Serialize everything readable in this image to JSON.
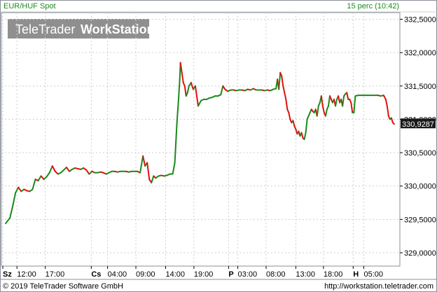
{
  "header": {
    "instrument": "EUR/HUF Spot",
    "period": "15 perc (10:42)"
  },
  "logo": {
    "prefix": "TeleTrader",
    "suffix": "WorkStation"
  },
  "footer": {
    "copyright": "© 2019 TeleTrader Software GmbH",
    "url": "http://workstation.teletrader.com"
  },
  "colors": {
    "up": "#1a8a1a",
    "down": "#e01010",
    "grid": "#cfcfcf",
    "last_label_bg": "#1a1a1a"
  },
  "chart_data": {
    "type": "line",
    "title": "EUR/HUF Spot",
    "ylim": [
      328.8,
      332.6
    ],
    "y_ticks": [
      "332,5000",
      "332,0000",
      "331,5000",
      "331,0000",
      "330,5000",
      "330,0000",
      "329,5000",
      "329,0000"
    ],
    "y_tick_values": [
      332.5,
      332.0,
      331.5,
      331.0,
      330.5,
      330.0,
      329.5,
      329.0
    ],
    "last_value": 330.9287,
    "last_value_label": "330,9287",
    "x_range": [
      0,
      563
    ],
    "x_ticks": [
      {
        "label": "Sz",
        "bold": true,
        "x": 2
      },
      {
        "label": "12:00",
        "bold": false,
        "x": 22
      },
      {
        "label": "17:00",
        "bold": false,
        "x": 62
      },
      {
        "label": "Cs",
        "bold": true,
        "x": 127
      },
      {
        "label": "04:00",
        "bold": false,
        "x": 150
      },
      {
        "label": "09:00",
        "bold": false,
        "x": 190
      },
      {
        "label": "14:00",
        "bold": false,
        "x": 232
      },
      {
        "label": "19:00",
        "bold": false,
        "x": 272
      },
      {
        "label": "P",
        "bold": true,
        "x": 321
      },
      {
        "label": "03:00",
        "bold": false,
        "x": 334
      },
      {
        "label": "08:00",
        "bold": false,
        "x": 374
      },
      {
        "label": "13:00",
        "bold": false,
        "x": 416
      },
      {
        "label": "18:00",
        "bold": false,
        "x": 455
      },
      {
        "label": "H",
        "bold": true,
        "x": 497
      },
      {
        "label": "05:00",
        "bold": false,
        "x": 512
      }
    ],
    "series": [
      {
        "values": [
          [
            6,
            329.44
          ],
          [
            12,
            329.52
          ],
          [
            16,
            329.7
          ],
          [
            20,
            329.9
          ],
          [
            24,
            329.98
          ],
          [
            28,
            329.92
          ],
          [
            32,
            329.95
          ],
          [
            36,
            329.93
          ],
          [
            40,
            329.92
          ],
          [
            44,
            329.95
          ],
          [
            48,
            330.1
          ],
          [
            52,
            330.08
          ],
          [
            56,
            330.15
          ],
          [
            60,
            330.1
          ],
          [
            64,
            330.14
          ],
          [
            68,
            330.2
          ],
          [
            72,
            330.3
          ],
          [
            76,
            330.22
          ],
          [
            80,
            330.18
          ],
          [
            84,
            330.2
          ],
          [
            88,
            330.24
          ],
          [
            92,
            330.28
          ],
          [
            96,
            330.22
          ],
          [
            100,
            330.25
          ],
          [
            104,
            330.27
          ],
          [
            108,
            330.26
          ],
          [
            112,
            330.25
          ],
          [
            116,
            330.27
          ],
          [
            120,
            330.24
          ],
          [
            124,
            330.18
          ],
          [
            128,
            330.22
          ],
          [
            132,
            330.2
          ],
          [
            136,
            330.2
          ],
          [
            140,
            330.21
          ],
          [
            144,
            330.2
          ],
          [
            148,
            330.18
          ],
          [
            152,
            330.2
          ],
          [
            156,
            330.22
          ],
          [
            160,
            330.22
          ],
          [
            164,
            330.21
          ],
          [
            168,
            330.22
          ],
          [
            172,
            330.22
          ],
          [
            176,
            330.22
          ],
          [
            180,
            330.21
          ],
          [
            184,
            330.22
          ],
          [
            188,
            330.22
          ],
          [
            192,
            330.22
          ],
          [
            196,
            330.2
          ],
          [
            200,
            330.45
          ],
          [
            203,
            330.3
          ],
          [
            206,
            330.35
          ],
          [
            209,
            330.1
          ],
          [
            212,
            330.05
          ],
          [
            215,
            330.15
          ],
          [
            218,
            330.12
          ],
          [
            222,
            330.15
          ],
          [
            226,
            330.16
          ],
          [
            230,
            330.15
          ],
          [
            234,
            330.16
          ],
          [
            238,
            330.18
          ],
          [
            242,
            330.18
          ],
          [
            245,
            330.35
          ],
          [
            248,
            330.95
          ],
          [
            250,
            331.25
          ],
          [
            252,
            331.6
          ],
          [
            253,
            331.85
          ],
          [
            255,
            331.7
          ],
          [
            257,
            331.55
          ],
          [
            259,
            331.5
          ],
          [
            261,
            331.35
          ],
          [
            263,
            331.4
          ],
          [
            265,
            331.5
          ],
          [
            268,
            331.55
          ],
          [
            271,
            331.45
          ],
          [
            274,
            331.5
          ],
          [
            276,
            331.35
          ],
          [
            278,
            331.2
          ],
          [
            282,
            331.28
          ],
          [
            286,
            331.3
          ],
          [
            290,
            331.3
          ],
          [
            294,
            331.32
          ],
          [
            298,
            331.33
          ],
          [
            302,
            331.35
          ],
          [
            306,
            331.35
          ],
          [
            310,
            331.37
          ],
          [
            313,
            331.5
          ],
          [
            316,
            331.45
          ],
          [
            320,
            331.42
          ],
          [
            324,
            331.44
          ],
          [
            328,
            331.44
          ],
          [
            332,
            331.43
          ],
          [
            336,
            331.44
          ],
          [
            340,
            331.44
          ],
          [
            344,
            331.43
          ],
          [
            348,
            331.45
          ],
          [
            352,
            331.44
          ],
          [
            356,
            331.46
          ],
          [
            360,
            331.44
          ],
          [
            364,
            331.44
          ],
          [
            368,
            331.44
          ],
          [
            372,
            331.43
          ],
          [
            376,
            331.44
          ],
          [
            380,
            331.43
          ],
          [
            384,
            331.45
          ],
          [
            388,
            331.46
          ],
          [
            390,
            331.6
          ],
          [
            392,
            331.45
          ],
          [
            394,
            331.7
          ],
          [
            396,
            331.65
          ],
          [
            398,
            331.5
          ],
          [
            400,
            331.4
          ],
          [
            402,
            331.3
          ],
          [
            404,
            331.15
          ],
          [
            406,
            331.1
          ],
          [
            408,
            331.0
          ],
          [
            410,
            330.95
          ],
          [
            412,
            330.98
          ],
          [
            414,
            330.9
          ],
          [
            416,
            330.85
          ],
          [
            418,
            330.78
          ],
          [
            420,
            330.82
          ],
          [
            422,
            330.75
          ],
          [
            424,
            330.8
          ],
          [
            426,
            330.72
          ],
          [
            428,
            330.7
          ],
          [
            430,
            330.8
          ],
          [
            432,
            331.0
          ],
          [
            434,
            331.05
          ],
          [
            436,
            331.1
          ],
          [
            438,
            331.15
          ],
          [
            440,
            331.12
          ],
          [
            442,
            331.1
          ],
          [
            444,
            331.15
          ],
          [
            446,
            331.05
          ],
          [
            448,
            331.2
          ],
          [
            450,
            331.25
          ],
          [
            452,
            331.35
          ],
          [
            454,
            331.2
          ],
          [
            456,
            331.1
          ],
          [
            458,
            331.05
          ],
          [
            460,
            331.15
          ],
          [
            462,
            331.2
          ],
          [
            464,
            331.35
          ],
          [
            466,
            331.3
          ],
          [
            468,
            331.25
          ],
          [
            470,
            331.3
          ],
          [
            472,
            331.2
          ],
          [
            474,
            331.3
          ],
          [
            476,
            331.35
          ],
          [
            478,
            331.25
          ],
          [
            480,
            331.3
          ],
          [
            482,
            331.2
          ],
          [
            484,
            331.35
          ],
          [
            486,
            331.38
          ],
          [
            488,
            331.4
          ],
          [
            490,
            331.3
          ],
          [
            492,
            331.3
          ],
          [
            494,
            331.25
          ],
          [
            496,
            331.1
          ],
          [
            498,
            331.1
          ],
          [
            500,
            331.35
          ],
          [
            504,
            331.36
          ],
          [
            508,
            331.36
          ],
          [
            512,
            331.36
          ],
          [
            516,
            331.36
          ],
          [
            520,
            331.36
          ],
          [
            524,
            331.36
          ],
          [
            528,
            331.36
          ],
          [
            532,
            331.36
          ],
          [
            536,
            331.35
          ],
          [
            540,
            331.36
          ],
          [
            543,
            331.3
          ],
          [
            545,
            331.2
          ],
          [
            547,
            331.05
          ],
          [
            549,
            331.0
          ],
          [
            551,
            331.02
          ],
          [
            553,
            330.95
          ],
          [
            555,
            330.93
          ]
        ]
      }
    ]
  }
}
